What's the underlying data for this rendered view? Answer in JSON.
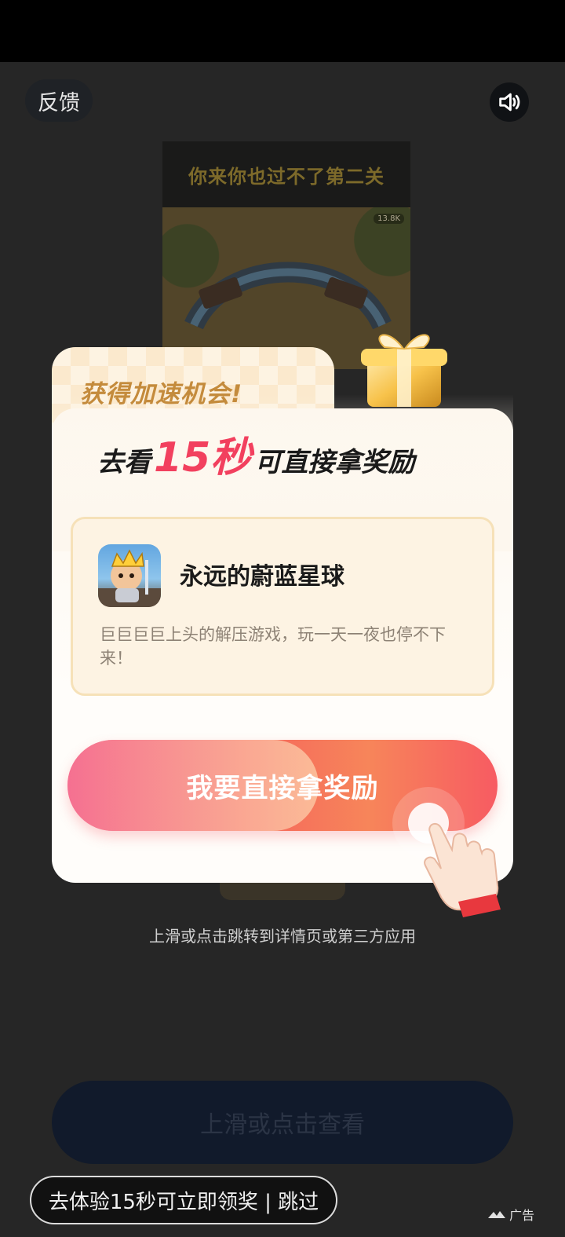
{
  "top_bar": {
    "feedback_label": "反馈",
    "sound_icon": "speaker-on-icon"
  },
  "video": {
    "title": "你来你也过不了第二关",
    "badge": "13.8K"
  },
  "modal": {
    "eyebrow": "获得加速机会!",
    "headline_prefix": "去看",
    "headline_number": "15秒",
    "headline_suffix": "可直接拿奖励",
    "app": {
      "icon": "game-app-icon",
      "name": "永远的蔚蓝星球",
      "description": "巨巨巨巨上头的解压游戏，玩一天一夜也停不下来！"
    },
    "cta_label": "我要直接拿奖励"
  },
  "hint_text": "上滑或点击跳转到详情页或第三方应用",
  "view_button_label": "上滑或点击查看",
  "skip_label": "去体验15秒可立即领奖 | 跳过",
  "ad_label": "广告",
  "colors": {
    "accent": "#f2405e",
    "eyebrow": "#c48b3c",
    "background": "#262626"
  }
}
